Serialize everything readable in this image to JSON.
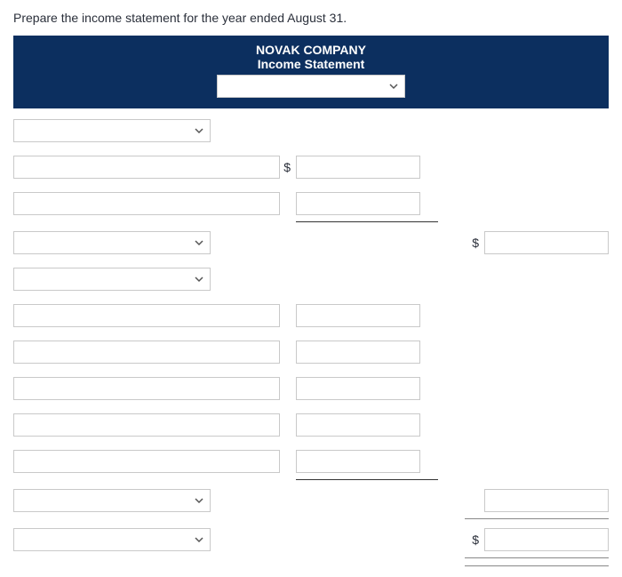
{
  "instruction": "Prepare the income statement for the year ended August 31.",
  "header": {
    "company": "NOVAK COMPANY",
    "title": "Income Statement",
    "period_select": ""
  },
  "rows": {
    "section1_select": "",
    "line1_label": "",
    "line1_value": "",
    "line2_label": "",
    "line2_value": "",
    "section1_total_select": "",
    "section1_total_value": "",
    "section2_select": "",
    "exp1_label": "",
    "exp1_value": "",
    "exp2_label": "",
    "exp2_value": "",
    "exp3_label": "",
    "exp3_value": "",
    "exp4_label": "",
    "exp4_value": "",
    "exp5_label": "",
    "exp5_value": "",
    "section2_total_select": "",
    "section2_total_value": "",
    "net_select": "",
    "net_value": ""
  },
  "symbols": {
    "dollar": "$"
  }
}
